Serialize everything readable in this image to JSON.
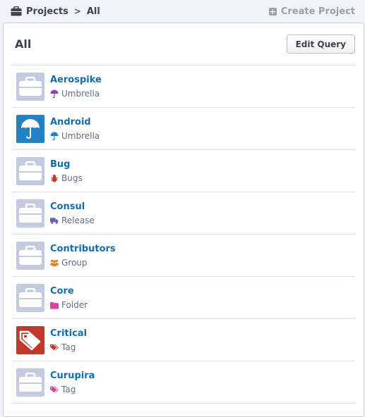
{
  "breadcrumb": {
    "icon": "briefcase-icon",
    "root": "Projects",
    "separator": ">",
    "current": "All"
  },
  "create_button": {
    "label": "Create Project",
    "icon": "plus-square-icon"
  },
  "panel": {
    "title": "All",
    "edit_label": "Edit Query"
  },
  "colors": {
    "link": "#136cb2",
    "umbrella": "#8e44ad",
    "umbrella_blue": "#2381c4",
    "bug": "#c0392b",
    "release": "#6e5cb6",
    "group": "#e67e22",
    "folder": "#e03ea5",
    "tag_red": "#c0392b",
    "tag_pink": "#e03ea5"
  },
  "projects": [
    {
      "name": "Aerospike",
      "type": "Umbrella",
      "type_icon": "umbrella-icon",
      "thumb": "briefcase-icon"
    },
    {
      "name": "Android",
      "type": "Umbrella",
      "type_icon": "umbrella-icon",
      "thumb": "umbrella-icon"
    },
    {
      "name": "Bug",
      "type": "Bugs",
      "type_icon": "bug-icon",
      "thumb": "briefcase-icon"
    },
    {
      "name": "Consul",
      "type": "Release",
      "type_icon": "truck-icon",
      "thumb": "briefcase-icon"
    },
    {
      "name": "Contributors",
      "type": "Group",
      "type_icon": "users-icon",
      "thumb": "briefcase-icon"
    },
    {
      "name": "Core",
      "type": "Folder",
      "type_icon": "folder-icon",
      "thumb": "briefcase-icon"
    },
    {
      "name": "Critical",
      "type": "Tag",
      "type_icon": "tag-icon",
      "thumb": "tags-icon"
    },
    {
      "name": "Curupira",
      "type": "Tag",
      "type_icon": "tag-icon",
      "thumb": "briefcase-icon"
    }
  ]
}
